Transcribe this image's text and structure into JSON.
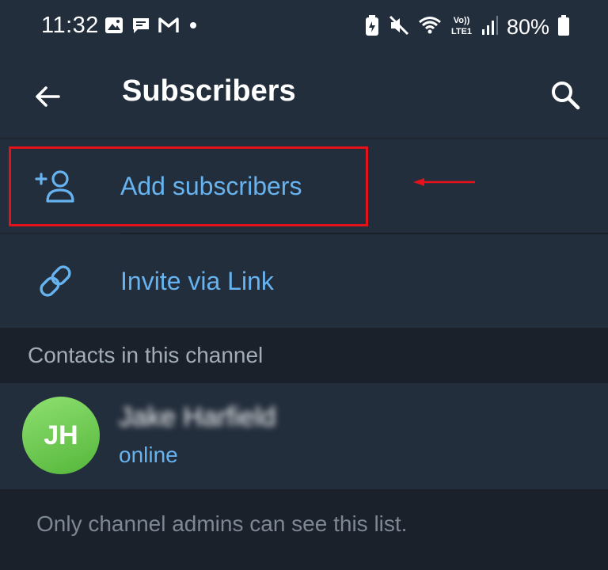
{
  "status_bar": {
    "time": "11:32",
    "battery_percent": "80%",
    "left_icons": [
      "image-icon",
      "message-icon",
      "gmail-icon",
      "dot-icon"
    ],
    "right_icons": [
      "battery-saver-icon",
      "mute-icon",
      "wifi-icon",
      "volte-icon",
      "signal-icon",
      "battery-icon"
    ],
    "volte_text": "Vo)) LTE1"
  },
  "app_bar": {
    "title": "Subscribers",
    "back_icon": "arrow-left-icon",
    "search_icon": "search-icon"
  },
  "actions": [
    {
      "label": "Add subscribers",
      "icon": "add-person-icon"
    },
    {
      "label": "Invite via Link",
      "icon": "link-icon"
    }
  ],
  "section": {
    "header": "Contacts in this channel"
  },
  "contacts": [
    {
      "initials": "JH",
      "name": "Jake Harfield",
      "status": "online"
    }
  ],
  "footer": {
    "note": "Only channel admins can see this list."
  },
  "colors": {
    "accent": "#66b3ef",
    "highlight": "#e3121b",
    "background": "#1d2530",
    "surface": "#232e3c",
    "avatar_green": "#55b63b"
  }
}
